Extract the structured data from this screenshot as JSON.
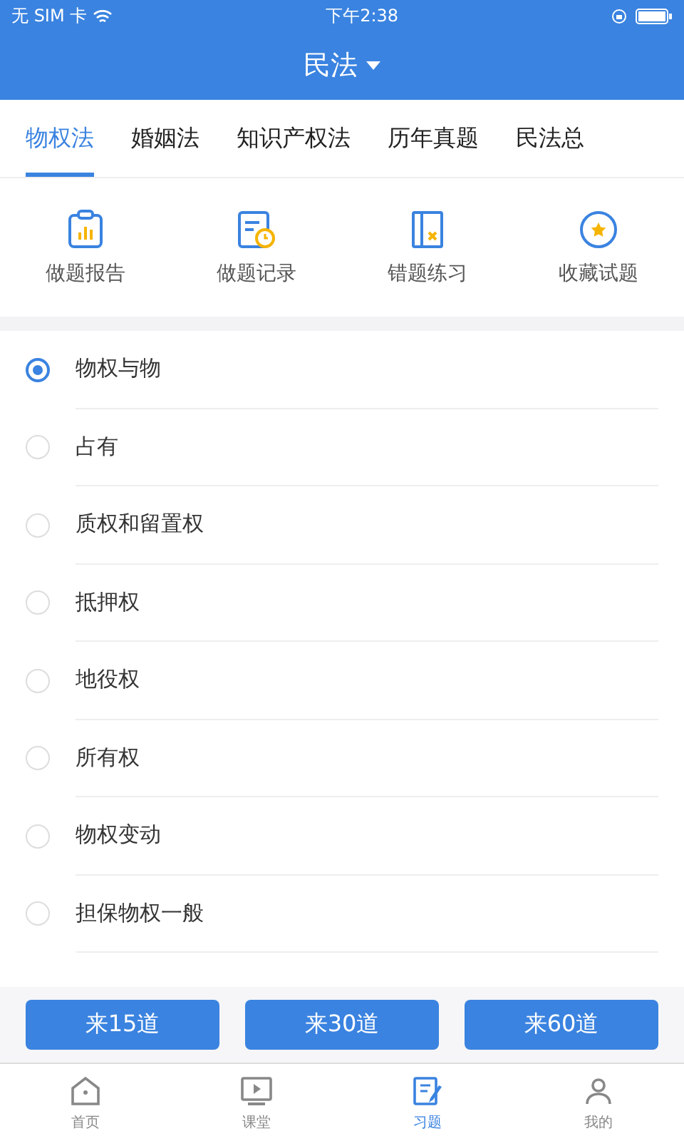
{
  "status_bar": {
    "carrier": "无 SIM 卡",
    "time": "下午2:38"
  },
  "header": {
    "title": "民法"
  },
  "tabs": [
    {
      "label": "物权法",
      "selected": true
    },
    {
      "label": "婚姻法",
      "selected": false
    },
    {
      "label": "知识产权法",
      "selected": false
    },
    {
      "label": "历年真题",
      "selected": false
    },
    {
      "label": "民法总",
      "selected": false
    }
  ],
  "actions": [
    {
      "kind": "report",
      "label": "做题报告"
    },
    {
      "kind": "record",
      "label": "做题记录"
    },
    {
      "kind": "wrong",
      "label": "错题练习"
    },
    {
      "kind": "favorite",
      "label": "收藏试题"
    }
  ],
  "chapters": [
    {
      "label": "物权与物",
      "selected": true
    },
    {
      "label": "占有",
      "selected": false
    },
    {
      "label": "质权和留置权",
      "selected": false
    },
    {
      "label": "抵押权",
      "selected": false
    },
    {
      "label": "地役权",
      "selected": false
    },
    {
      "label": "所有权",
      "selected": false
    },
    {
      "label": "物权变动",
      "selected": false
    },
    {
      "label": "担保物权一般",
      "selected": false
    }
  ],
  "quiz_buttons": [
    "来15道",
    "来30道",
    "来60道"
  ],
  "bottom_nav": [
    {
      "kind": "home",
      "label": "首页",
      "selected": false
    },
    {
      "kind": "class",
      "label": "课堂",
      "selected": false
    },
    {
      "kind": "exercise",
      "label": "习题",
      "selected": true
    },
    {
      "kind": "me",
      "label": "我的",
      "selected": false
    }
  ]
}
